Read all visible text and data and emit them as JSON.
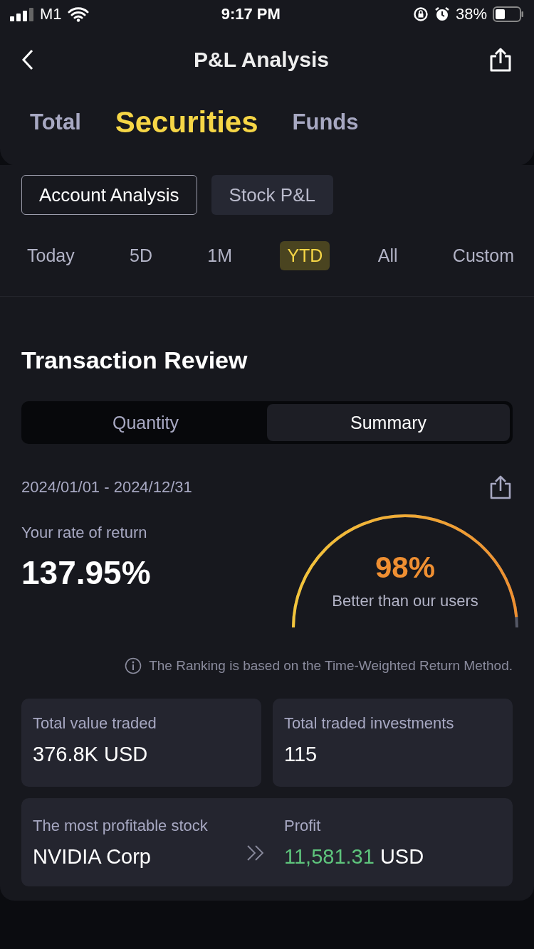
{
  "status_bar": {
    "carrier": "M1",
    "time": "9:17 PM",
    "battery": "38%"
  },
  "header": {
    "title": "P&L Analysis"
  },
  "tabs": [
    {
      "label": "Total",
      "selected": false
    },
    {
      "label": "Securities",
      "selected": true
    },
    {
      "label": "Funds",
      "selected": false
    }
  ],
  "views": [
    {
      "label": "Account Analysis",
      "selected": true
    },
    {
      "label": "Stock P&L",
      "selected": false
    }
  ],
  "periods": [
    {
      "label": "Today",
      "selected": false
    },
    {
      "label": "5D",
      "selected": false
    },
    {
      "label": "1M",
      "selected": false
    },
    {
      "label": "YTD",
      "selected": true
    },
    {
      "label": "All",
      "selected": false
    },
    {
      "label": "Custom",
      "selected": false
    }
  ],
  "review": {
    "title": "Transaction Review",
    "toggle": [
      {
        "label": "Quantity",
        "selected": false
      },
      {
        "label": "Summary",
        "selected": true
      }
    ],
    "date_range": "2024/01/01 - 2024/12/31",
    "rate_label": "Your rate of return",
    "rate": "137.95%",
    "gauge": {
      "percent": "98%",
      "caption": "Better than our users"
    },
    "note": "The Ranking is based on the Time-Weighted Return Method.",
    "stats": [
      {
        "label": "Total value traded",
        "value": "376.8K USD"
      },
      {
        "label": "Total traded investments",
        "value": "115"
      }
    ],
    "top_stock": {
      "label": "The most profitable stock",
      "name": "NVIDIA Corp",
      "profit_label": "Profit",
      "profit": "11,581.31",
      "currency": "USD"
    }
  }
}
